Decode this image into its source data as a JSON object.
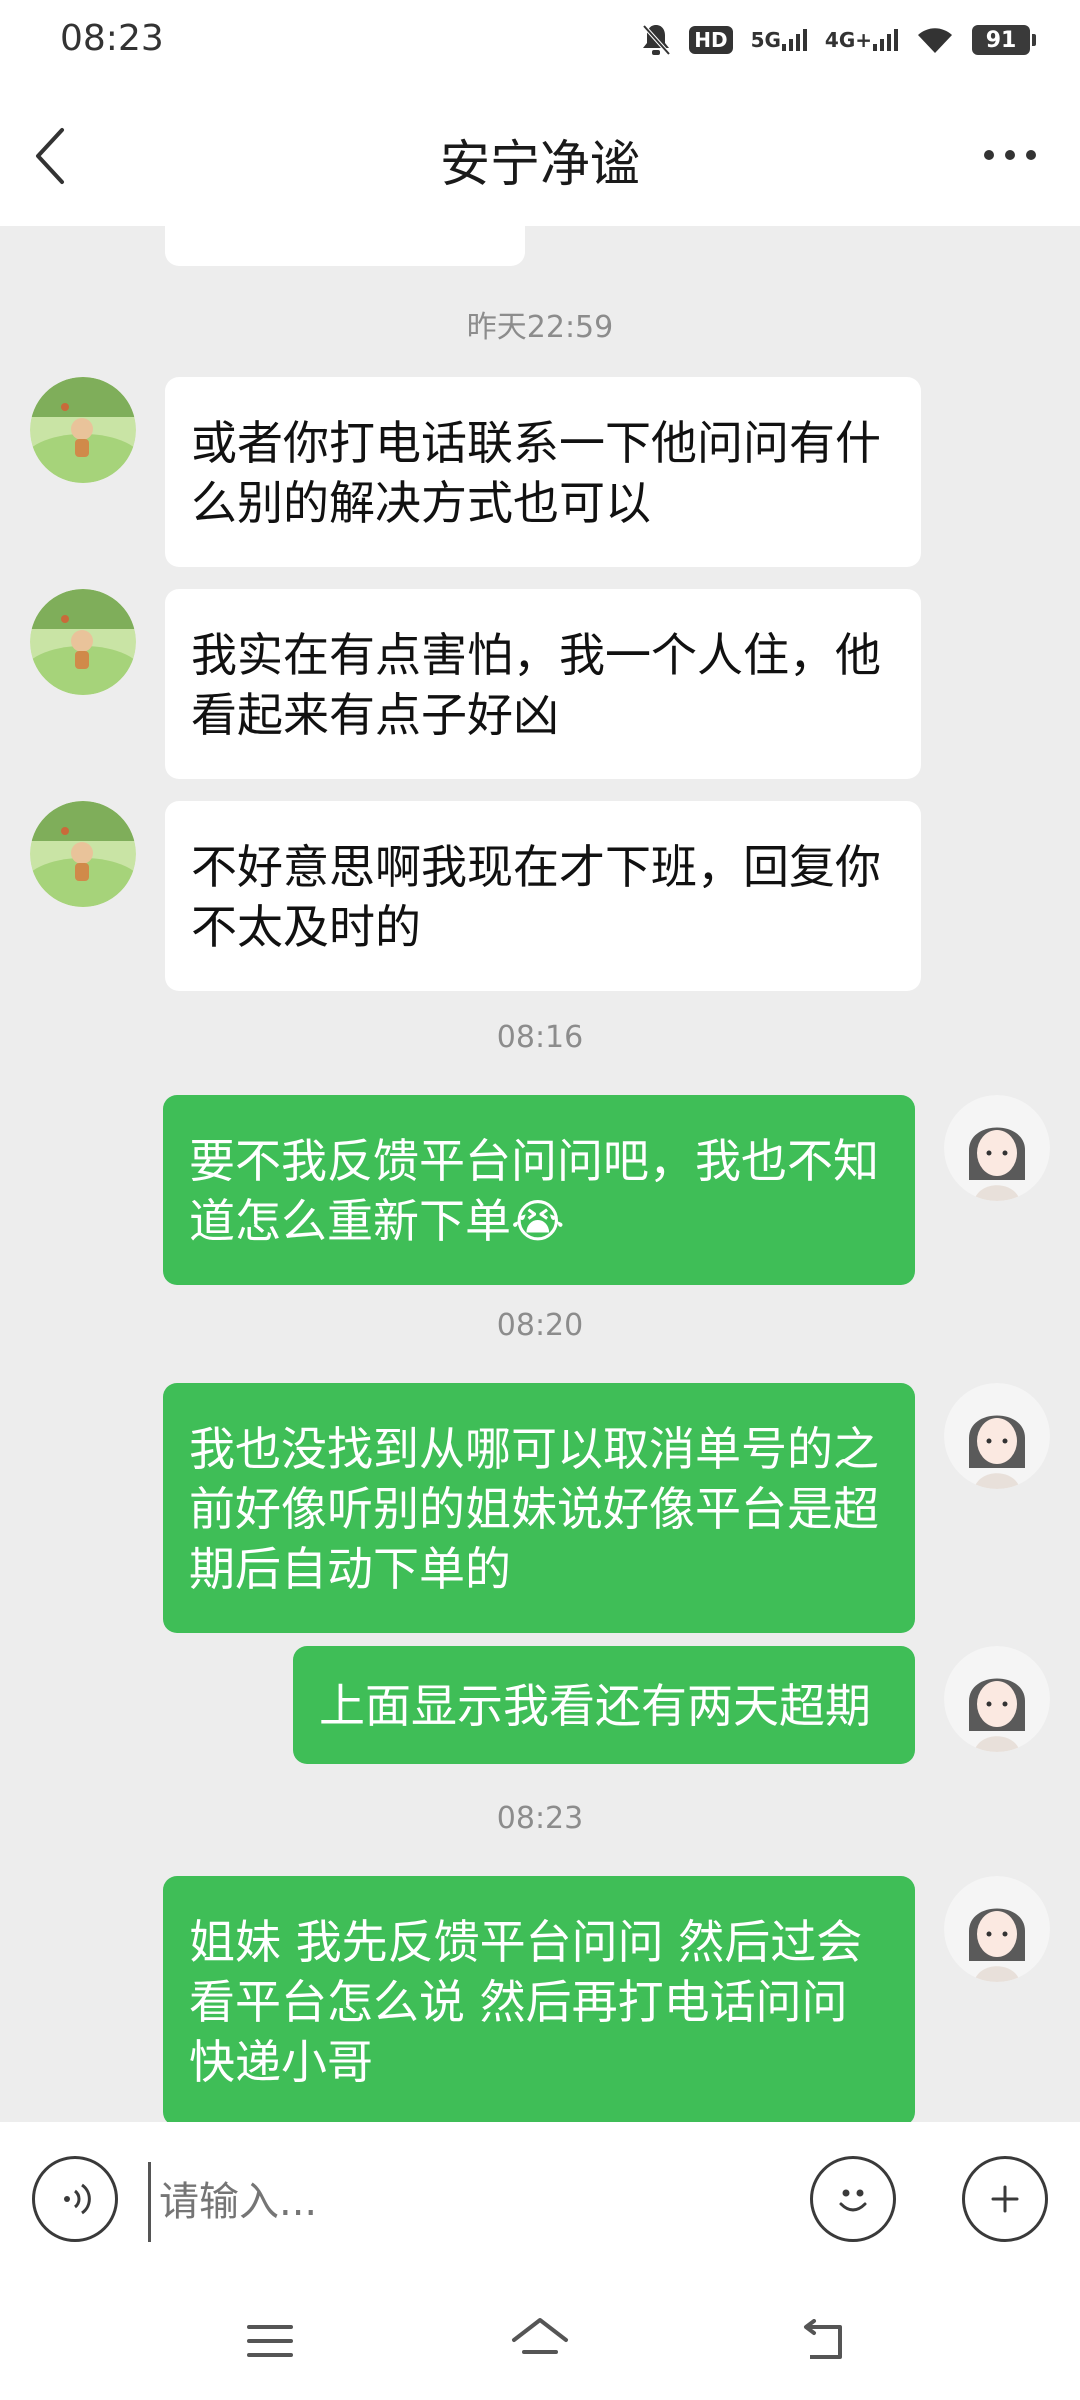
{
  "status_bar": {
    "time": "08:23",
    "hd_label": "HD",
    "net1": "5G",
    "net2": "4G+",
    "battery": "91"
  },
  "header": {
    "title": "安宁净谧"
  },
  "messages": {
    "sep1": "昨天22:59",
    "m1": "或者你打电话联系一下他问问有什么别的解决方式也可以",
    "m2": "我实在有点害怕，我一个人住，他看起来有点子好凶",
    "m3": "不好意思啊我现在才下班，回复你不太及时的",
    "sep2": "08:16",
    "m4": "要不我反馈平台问问吧，我也不知道怎么重新下单😭",
    "sep3": "08:20",
    "m5": "我也没找到从哪可以取消单号的之前好像听别的姐妹说好像平台是超期后自动下单的",
    "m6": "上面显示我看还有两天超期",
    "sep4": "08:23",
    "m7": "姐妹 我先反馈平台问问  然后过会看平台怎么说   然后再打电话问问快递小哥"
  },
  "input": {
    "placeholder": "请输入..."
  },
  "colors": {
    "sent_bubble": "#3fbe57",
    "received_bubble": "#ffffff",
    "chat_bg": "#ededed"
  }
}
